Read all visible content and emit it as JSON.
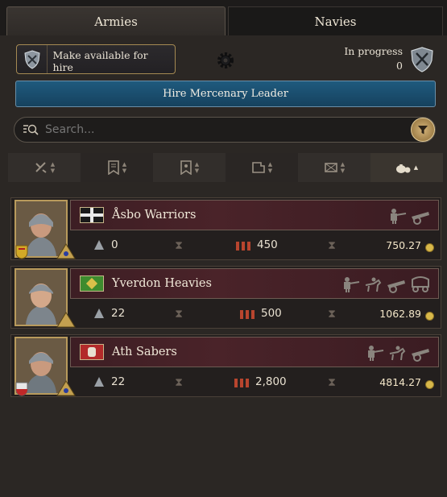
{
  "tabs": {
    "armies": "Armies",
    "navies": "Navies"
  },
  "controls": {
    "hire_toggle_label": "Make available for hire",
    "in_progress_label": "In progress",
    "in_progress_count": "0",
    "hire_leader_label": "Hire Mercenary Leader"
  },
  "search": {
    "placeholder": "Search..."
  },
  "sort_columns": [
    "regiment-type-sort",
    "banner-sort",
    "banner-alt-sort",
    "siege-sort",
    "maintenance-sort",
    "cost-sort"
  ],
  "mercenaries": [
    {
      "name": "Åsbo Warriors",
      "flag": "black-cross",
      "count": "0",
      "men": "450",
      "cost": "750.27",
      "unit_icons": [
        "artillery-infantry-icon",
        "cannon-icon"
      ]
    },
    {
      "name": "Yverdon Heavies",
      "flag": "green-gold",
      "count": "22",
      "men": "500",
      "cost": "1062.89",
      "unit_icons": [
        "infantry-icon",
        "cavalry-icon",
        "cannon-icon",
        "wagon-icon"
      ]
    },
    {
      "name": "Ath Sabers",
      "flag": "red-lion",
      "count": "22",
      "men": "2,800",
      "cost": "4814.27",
      "unit_icons": [
        "infantry-icon",
        "cavalry-icon",
        "cannon-icon"
      ]
    }
  ],
  "colors": {
    "accent_blue": "#1f5a7e",
    "gold": "#d8b84a",
    "row_header": "#4a2329"
  }
}
